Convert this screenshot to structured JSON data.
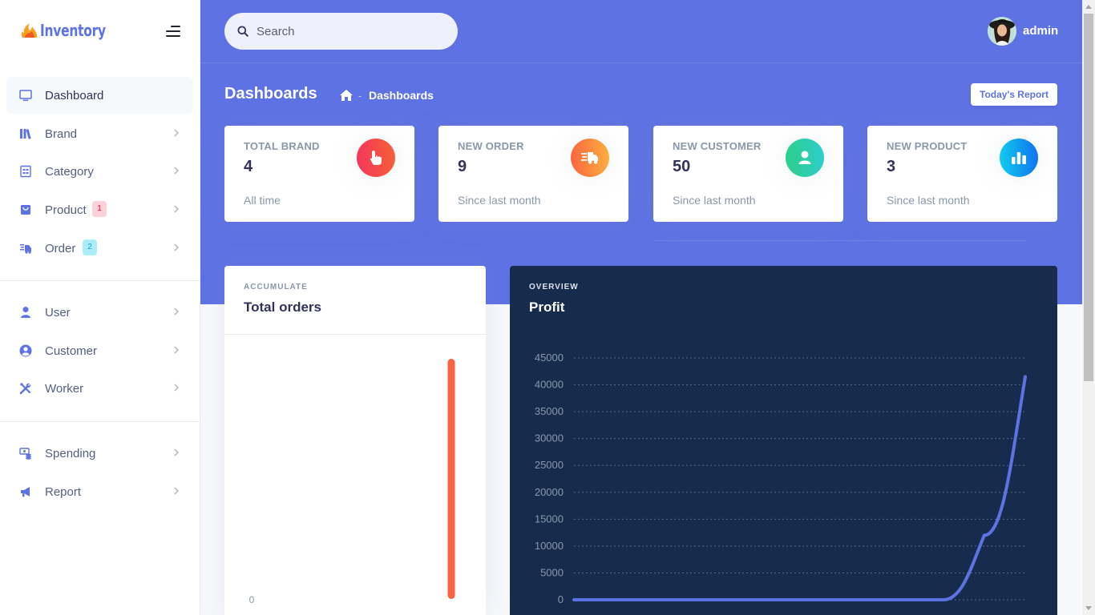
{
  "app": {
    "name": "Inventory"
  },
  "sidebar": {
    "items": [
      {
        "label": "Dashboard",
        "icon": "monitor-icon",
        "active": true
      },
      {
        "label": "Brand",
        "icon": "books-icon"
      },
      {
        "label": "Category",
        "icon": "category-icon"
      },
      {
        "label": "Product",
        "icon": "shopping-bag-icon",
        "badge": "1"
      },
      {
        "label": "Order",
        "icon": "delivery-icon",
        "badge": "2"
      },
      {
        "label": "User",
        "icon": "user-icon"
      },
      {
        "label": "Customer",
        "icon": "user-circle-icon"
      },
      {
        "label": "Worker",
        "icon": "tools-icon"
      },
      {
        "label": "Spending",
        "icon": "money-icon"
      },
      {
        "label": "Report",
        "icon": "megaphone-icon"
      }
    ]
  },
  "header": {
    "search_placeholder": "Search",
    "user_name": "admin"
  },
  "page": {
    "title": "Dashboards",
    "breadcrumb": "Dashboards",
    "breadcrumb_separator": "-",
    "report_button": "Today's Report"
  },
  "stats": [
    {
      "title": "TOTAL BRAND",
      "value": "4",
      "sub": "All time",
      "icon": "hand-pointer-icon",
      "color": "#f5365c"
    },
    {
      "title": "NEW ORDER",
      "value": "9",
      "sub": "Since last month",
      "icon": "truck-icon",
      "color": "#fb6340"
    },
    {
      "title": "NEW CUSTOMER",
      "value": "50",
      "sub": "Since last month",
      "icon": "user-icon",
      "color": "#2dce89"
    },
    {
      "title": "NEW PRODUCT",
      "value": "3",
      "sub": "Since last month",
      "icon": "bar-chart-icon",
      "color": "#11cdef"
    }
  ],
  "orders_card": {
    "eyebrow": "ACCUMULATE",
    "title": "Total orders"
  },
  "profit_card": {
    "eyebrow": "OVERVIEW",
    "title": "Profit"
  },
  "colors": {
    "primary": "#5e72e4",
    "dark_card": "#172b4d",
    "orders_bar": "#fb6340"
  },
  "chart_data": [
    {
      "type": "bar",
      "title": "Total orders",
      "ylim": [
        0,
        null
      ],
      "y_tick_labels": [
        "0"
      ],
      "categories": [
        ""
      ],
      "values": [
        1
      ]
    },
    {
      "type": "line",
      "title": "Profit",
      "ylim": [
        0,
        45000
      ],
      "y_ticks": [
        0,
        5000,
        10000,
        15000,
        20000,
        25000,
        30000,
        35000,
        40000,
        45000
      ],
      "x": [
        0,
        1,
        2,
        3,
        4,
        5,
        6,
        7,
        8,
        9,
        10,
        11
      ],
      "series": [
        {
          "values": [
            0,
            0,
            0,
            0,
            0,
            0,
            0,
            0,
            0,
            0,
            12000,
            41500
          ]
        }
      ],
      "grid": true,
      "legend": "none"
    }
  ]
}
